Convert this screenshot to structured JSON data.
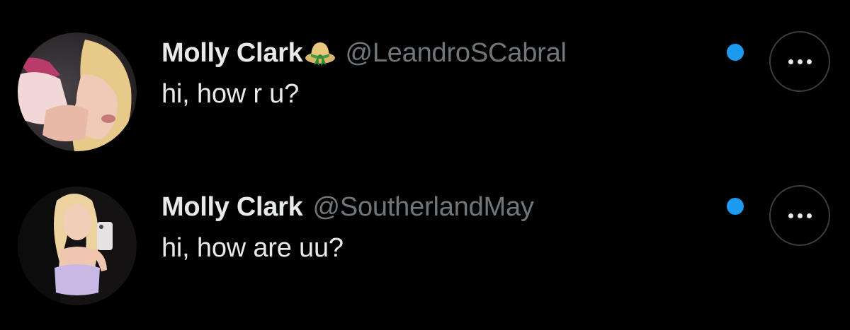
{
  "colors": {
    "background": "#000000",
    "primary_text": "#E7E9EA",
    "secondary_text": "#71767B",
    "unread_dot": "#1D9BF0",
    "more_button_border": "#3a3d41"
  },
  "conversations": [
    {
      "display_name": "Molly Clark",
      "badge_icon": "straw-hat-emoji",
      "handle": "@LeandroSCabral",
      "message_preview": "hi, how r u?",
      "unread": true,
      "more_icon": "ellipsis-icon"
    },
    {
      "display_name": "Molly Clark",
      "badge_icon": "",
      "handle": "@SoutherlandMay",
      "message_preview": "hi, how are uu?",
      "unread": true,
      "more_icon": "ellipsis-icon"
    }
  ]
}
